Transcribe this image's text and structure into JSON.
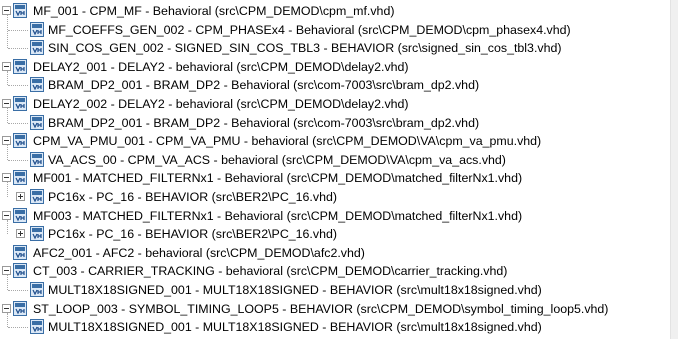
{
  "tree": {
    "nodes": [
      {
        "label": "MF_001 - CPM_MF - Behavioral (src\\CPM_DEMOD\\cpm_mf.vhd)",
        "expander": "minus"
      },
      {
        "label": "MF_COEFFS_GEN_002 - CPM_PHASEx4 - Behavioral (src\\CPM_DEMOD\\cpm_phasex4.vhd)",
        "expander": "none"
      },
      {
        "label": "SIN_COS_GEN_002 - SIGNED_SIN_COS_TBL3 - BEHAVIOR (src\\signed_sin_cos_tbl3.vhd)",
        "expander": "none"
      },
      {
        "label": "DELAY2_001 - DELAY2 - behavioral (src\\CPM_DEMOD\\delay2.vhd)",
        "expander": "minus"
      },
      {
        "label": "BRAM_DP2_001 - BRAM_DP2 - Behavioral (src\\com-7003\\src\\bram_dp2.vhd)",
        "expander": "none"
      },
      {
        "label": "DELAY2_002 - DELAY2 - behavioral (src\\CPM_DEMOD\\delay2.vhd)",
        "expander": "minus"
      },
      {
        "label": "BRAM_DP2_001 - BRAM_DP2 - Behavioral (src\\com-7003\\src\\bram_dp2.vhd)",
        "expander": "none"
      },
      {
        "label": "CPM_VA_PMU_001 - CPM_VA_PMU - behavioral (src\\CPM_DEMOD\\VA\\cpm_va_pmu.vhd)",
        "expander": "minus"
      },
      {
        "label": "VA_ACS_00 - CPM_VA_ACS - behavioral (src\\CPM_DEMOD\\VA\\cpm_va_acs.vhd)",
        "expander": "none"
      },
      {
        "label": "MF001 - MATCHED_FILTERNx1 - Behavioral (src\\CPM_DEMOD\\matched_filterNx1.vhd)",
        "expander": "minus"
      },
      {
        "label": "PC16x - PC_16 - BEHAVIOR (src\\BER2\\PC_16.vhd)",
        "expander": "plus"
      },
      {
        "label": "MF003 - MATCHED_FILTERNx1 - Behavioral (src\\CPM_DEMOD\\matched_filterNx1.vhd)",
        "expander": "minus"
      },
      {
        "label": "PC16x - PC_16 - BEHAVIOR (src\\BER2\\PC_16.vhd)",
        "expander": "plus"
      },
      {
        "label": "AFC2_001 - AFC2 - behavioral (src\\CPM_DEMOD\\afc2.vhd)",
        "expander": "none"
      },
      {
        "label": "CT_003 - CARRIER_TRACKING - behavioral (src\\CPM_DEMOD\\carrier_tracking.vhd)",
        "expander": "minus"
      },
      {
        "label": "MULT18X18SIGNED_001 - MULT18X18SIGNED - BEHAVIOR (src\\mult18x18signed.vhd)",
        "expander": "none"
      },
      {
        "label": "ST_LOOP_003 - SYMBOL_TIMING_LOOP5 - BEHAVIOR (src\\CPM_DEMOD\\symbol_timing_loop5.vhd)",
        "expander": "minus"
      },
      {
        "label": "MULT18X18SIGNED_001 - MULT18X18SIGNED - BEHAVIOR (src\\mult18x18signed.vhd)",
        "expander": "none"
      }
    ],
    "icon_name": "vhdl-module-icon",
    "colors": {
      "icon_border": "#3a6ea5",
      "icon_fill": "#dbe8f6",
      "icon_text": "#1f4e8c",
      "connector": "#a8a8a8"
    }
  }
}
